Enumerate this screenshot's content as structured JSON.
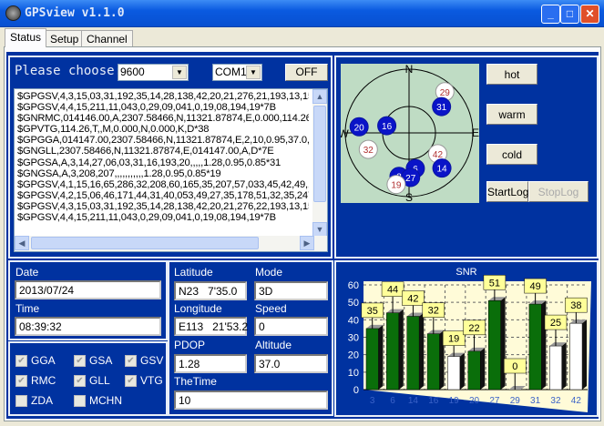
{
  "window": {
    "title": "GPSview v1.1.0",
    "min": "_",
    "max": "□",
    "close": "✕"
  },
  "tabs": [
    {
      "label": "Status"
    },
    {
      "label": "Setup"
    },
    {
      "label": "Channel"
    }
  ],
  "controls": {
    "prompt": "Please choose:",
    "baud": "9600",
    "port": "COM1",
    "toggle": "OFF"
  },
  "nmea": [
    "$GPGSV,4,3,15,03,31,192,35,14,28,138,42,20,21,276,21,193,13,15",
    "$GPGSV,4,4,15,211,11,043,0,29,09,041,0,19,08,194,19*7B",
    "$GNRMC,014146.00,A,2307.58466,N,11321.87874,E,0.000,114.26",
    "$GPVTG,114.26,T,,M,0.000,N,0.000,K,D*38",
    "$GPGGA,014147.00,2307.58466,N,11321.87874,E,2,10,0.95,37.0,M",
    "$GNGLL,2307.58466,N,11321.87874,E,014147.00,A,D*7E",
    "$GPGSA,A,3,14,27,06,03,31,16,193,20,,,,,1.28,0.95,0.85*31",
    "$GNGSA,A,3,208,207,,,,,,,,,,,1.28,0.95,0.85*19",
    "$GPGSV,4,1,15,16,65,286,32,208,60,165,35,207,57,033,45,42,49,1",
    "$GPGSV,4,2,15,06,46,171,44,31,40,053,49,27,35,178,51,32,35,247",
    "$GPGSV,4,3,15,03,31,192,35,14,28,138,42,20,21,276,22,193,13,15",
    "$GPGSV,4,4,15,211,11,043,0,29,09,041,0,19,08,194,19*7B"
  ],
  "sky": {
    "labels": {
      "n": "N",
      "s": "S",
      "e": "E",
      "w": "W"
    },
    "satellites": [
      {
        "id": "29",
        "az": 41,
        "el": 13,
        "used": false
      },
      {
        "id": "31",
        "az": 51,
        "el": 31,
        "used": true
      },
      {
        "id": "20",
        "az": 277,
        "el": 19,
        "used": true
      },
      {
        "id": "16",
        "az": 288,
        "el": 57,
        "used": true
      },
      {
        "id": "32",
        "az": 248,
        "el": 28,
        "used": false
      },
      {
        "id": "42",
        "az": 126,
        "el": 40,
        "used": false
      },
      {
        "id": "14",
        "az": 137,
        "el": 22,
        "used": true
      },
      {
        "id": "6",
        "az": 170,
        "el": 39,
        "used": true
      },
      {
        "id": "3",
        "az": 193,
        "el": 27,
        "used": true
      },
      {
        "id": "27",
        "az": 178,
        "el": 27,
        "used": true
      },
      {
        "id": "19",
        "az": 194,
        "el": 15,
        "used": false
      }
    ]
  },
  "buttons": {
    "hot": "hot",
    "warm": "warm",
    "cold": "cold",
    "start_log": "StartLog",
    "stop_log": "StopLog"
  },
  "datetime": {
    "date_label": "Date",
    "date": "2013/07/24",
    "time_label": "Time",
    "time": "08:39:32"
  },
  "sentences": [
    {
      "label": "GGA",
      "checked": true
    },
    {
      "label": "GSA",
      "checked": true
    },
    {
      "label": "GSV",
      "checked": true
    },
    {
      "label": "RMC",
      "checked": true
    },
    {
      "label": "GLL",
      "checked": true
    },
    {
      "label": "VTG",
      "checked": true
    },
    {
      "label": "ZDA",
      "checked": false
    },
    {
      "label": "MCHN",
      "checked": false
    }
  ],
  "position": {
    "lat_label": "Latitude",
    "lat": "N23   7'35.0",
    "mode_label": "Mode",
    "mode": "3D",
    "lon_label": "Longitude",
    "lon": "E113   21'53.2",
    "speed_label": "Speed",
    "speed": "0",
    "pdop_label": "PDOP",
    "pdop": "1.28",
    "alt_label": "Altitude",
    "alt": "37.0",
    "thetime_label": "TheTime",
    "thetime": "10"
  },
  "colors": {
    "used": "#0a6e0a",
    "unused": "#ffffff",
    "panel": "#0032a0",
    "label_bg": "#ffff99"
  },
  "chart_data": {
    "type": "bar",
    "title": "SNR",
    "categories": [
      "3",
      "6",
      "14",
      "16",
      "19",
      "20",
      "27",
      "29",
      "31",
      "32",
      "42"
    ],
    "values": [
      35,
      44,
      42,
      32,
      19,
      22,
      51,
      0,
      49,
      25,
      38
    ],
    "used": [
      true,
      true,
      true,
      true,
      false,
      true,
      true,
      false,
      true,
      false,
      false
    ],
    "ylim": [
      0,
      60
    ],
    "yticks": [
      0,
      10,
      20,
      30,
      40,
      50,
      60
    ],
    "grid": true
  }
}
